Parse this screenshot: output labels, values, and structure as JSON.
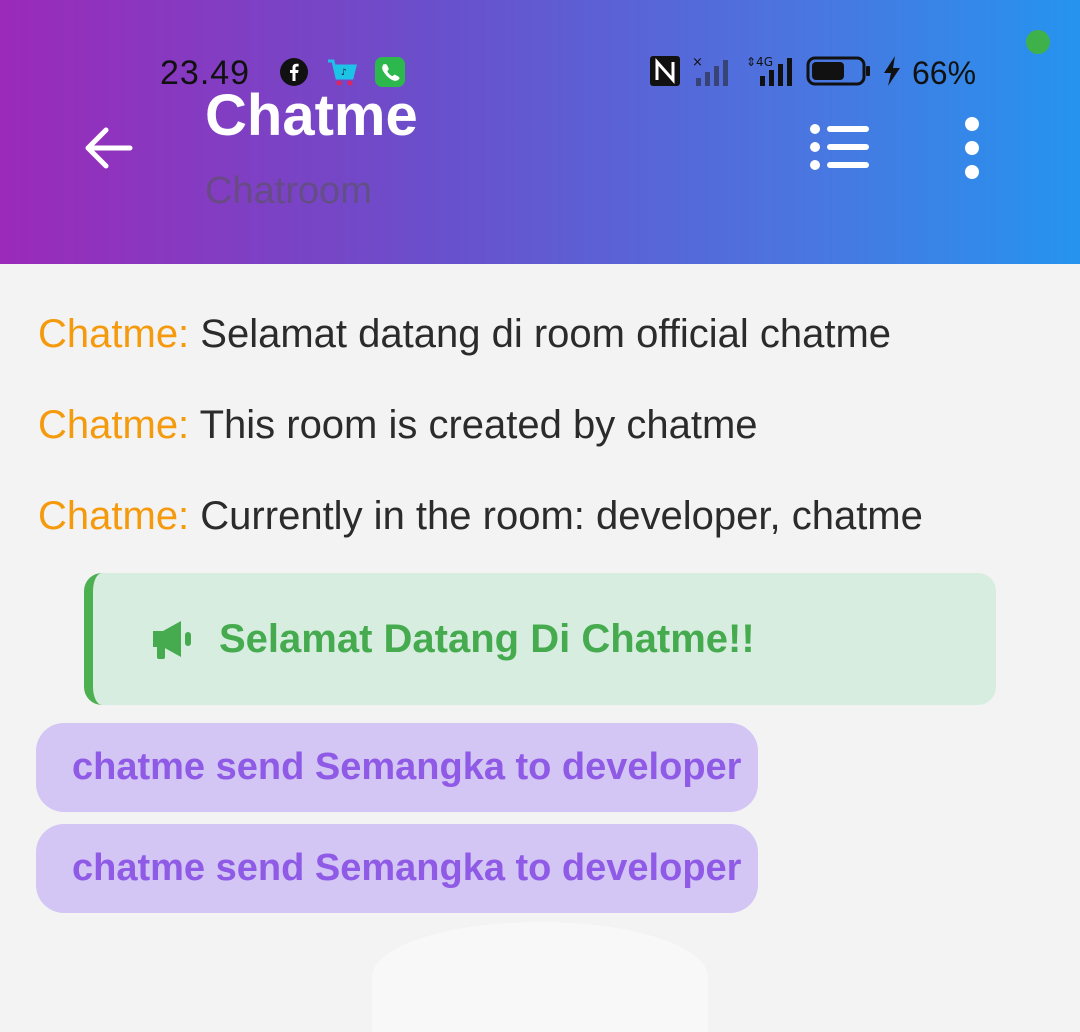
{
  "status_bar": {
    "time": "23.49",
    "left_icons": [
      "facebook-icon",
      "tiktok-shop-icon",
      "phone-app-icon"
    ],
    "right_icons": [
      "nfc-icon",
      "signal-no-service-icon",
      "signal-4g-icon",
      "battery-icon",
      "charging-icon"
    ],
    "battery_percent": "66%",
    "battery_level": 0.66
  },
  "header": {
    "title": "Chatme",
    "subtitle": "Chatroom",
    "back_icon": "arrow-left-icon",
    "menu_icon": "list-icon",
    "more_icon": "more-vertical-icon",
    "gradient_colors": [
      "#9b2ab9",
      "#2594ef"
    ]
  },
  "messages": [
    {
      "sender": "Chatme:",
      "text": "Selamat datang di room official chatme"
    },
    {
      "sender": "Chatme:",
      "text": "This room is created by chatme"
    },
    {
      "sender": "Chatme:",
      "text": "Currently in the room: developer, chatme"
    }
  ],
  "announcement": {
    "icon": "megaphone-icon",
    "text": "Selamat Datang Di Chatme!!",
    "color": "#46ab4f"
  },
  "gifts": [
    {
      "text": "chatme send Semangka to developer"
    },
    {
      "text": "chatme send Semangka to developer"
    }
  ],
  "colors": {
    "sender": "#f59a0c",
    "gift_bg": "#d4c6f4",
    "gift_text": "#8f5ae6"
  }
}
